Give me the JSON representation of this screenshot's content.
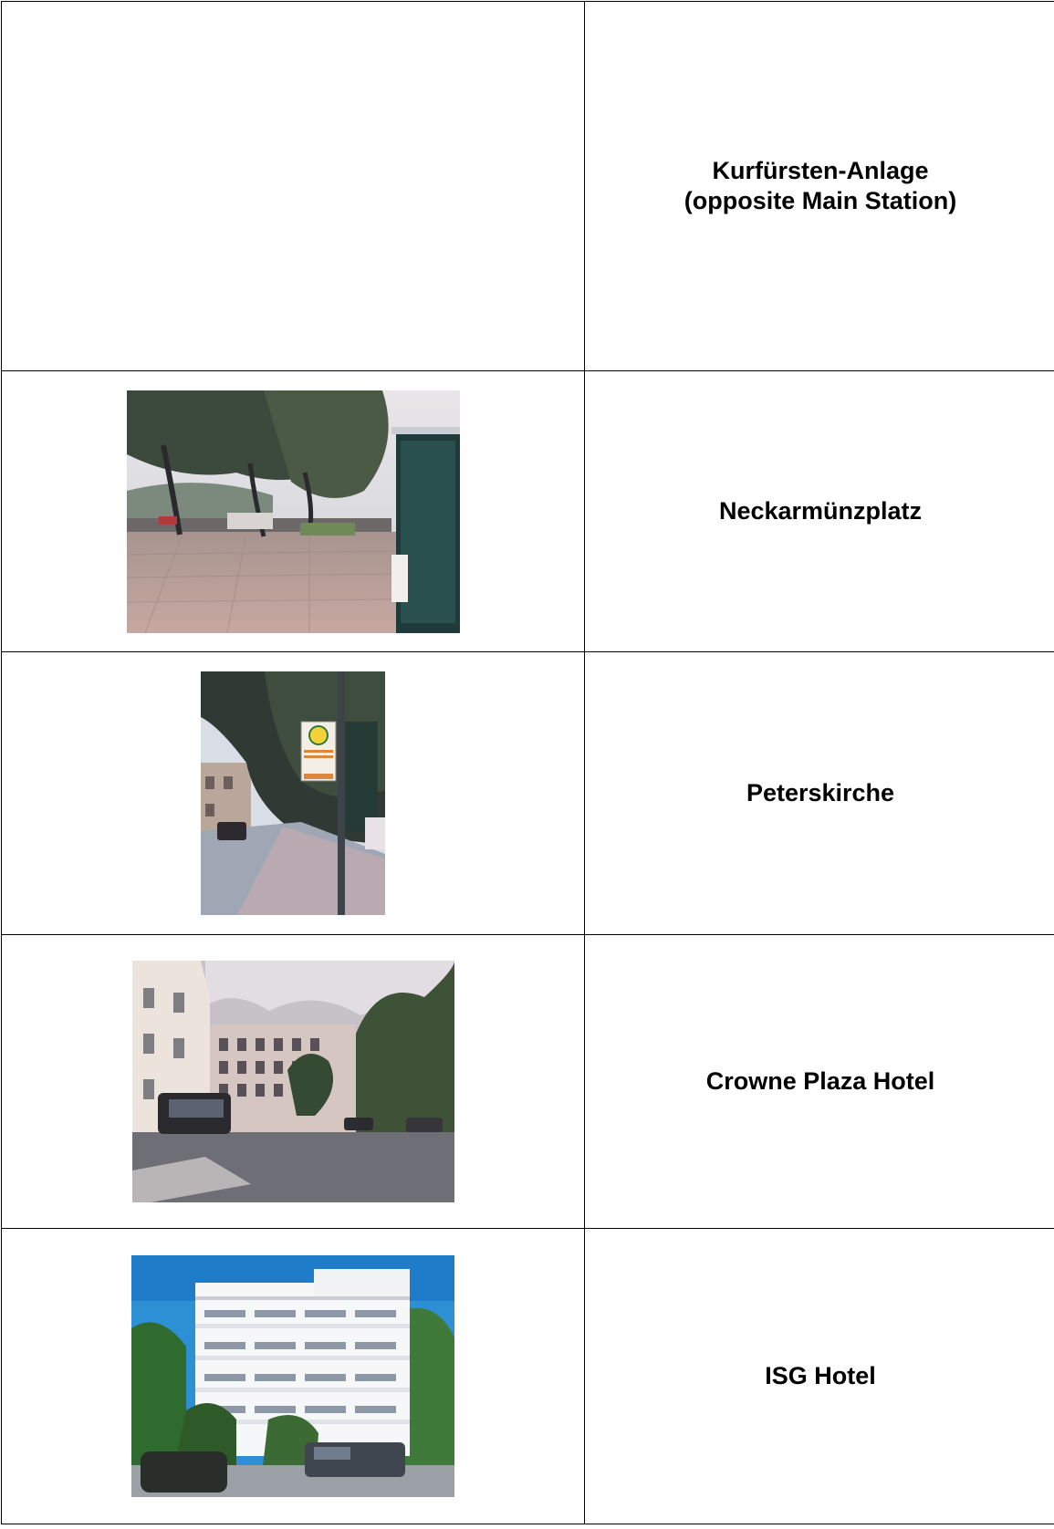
{
  "stops": [
    {
      "name": "Kurfürsten-Anlage\n(opposite Main Station)",
      "photo": "none"
    },
    {
      "name": "Neckarmünzplatz",
      "photo": "plaza-with-trees-and-bus-shelter"
    },
    {
      "name": "Peterskirche",
      "photo": "street-bus-stop-sign-under-tree"
    },
    {
      "name": "Crowne Plaza Hotel",
      "photo": "square-with-coach-and-buildings"
    },
    {
      "name": "ISG Hotel",
      "photo": "white-hotel-building-with-parked-cars"
    }
  ]
}
